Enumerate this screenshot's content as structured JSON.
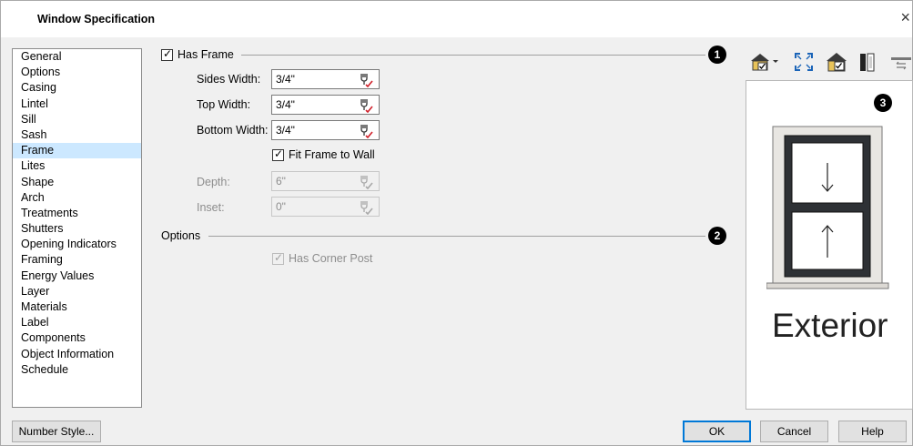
{
  "window": {
    "title": "Window Specification",
    "close_glyph": "×"
  },
  "nav": {
    "items": [
      {
        "label": "General"
      },
      {
        "label": "Options"
      },
      {
        "label": "Casing"
      },
      {
        "label": "Lintel"
      },
      {
        "label": "Sill"
      },
      {
        "label": "Sash"
      },
      {
        "label": "Frame",
        "selected": true
      },
      {
        "label": "Lites"
      },
      {
        "label": "Shape"
      },
      {
        "label": "Arch"
      },
      {
        "label": "Treatments"
      },
      {
        "label": "Shutters"
      },
      {
        "label": "Opening Indicators"
      },
      {
        "label": "Framing"
      },
      {
        "label": "Energy Values"
      },
      {
        "label": "Layer"
      },
      {
        "label": "Materials"
      },
      {
        "label": "Label"
      },
      {
        "label": "Components"
      },
      {
        "label": "Object Information"
      },
      {
        "label": "Schedule"
      }
    ]
  },
  "frame": {
    "has_frame_label": "Has Frame",
    "has_frame_checked": true,
    "sides_width_label": "Sides Width:",
    "sides_width_value": "3/4\"",
    "top_width_label": "Top Width:",
    "top_width_value": "3/4\"",
    "bottom_width_label": "Bottom Width:",
    "bottom_width_value": "3/4\"",
    "fit_frame_label": "Fit Frame to Wall",
    "fit_frame_checked": true,
    "depth_label": "Depth:",
    "depth_value": "6\"",
    "inset_label": "Inset:",
    "inset_value": "0\""
  },
  "options": {
    "group_label": "Options",
    "corner_post_label": "Has Corner Post",
    "corner_post_checked": true
  },
  "badges": {
    "one": "1",
    "two": "2",
    "three": "3"
  },
  "preview": {
    "caption": "Exterior"
  },
  "buttons": {
    "number_style": "Number Style...",
    "ok": "OK",
    "cancel": "Cancel",
    "help": "Help"
  },
  "icons": {
    "calculator": "calculator-icon",
    "toolbar": [
      "view-mode-dropdown-icon",
      "fill-window-icon",
      "color-view-icon",
      "side-view-icon",
      "flip-icon"
    ]
  },
  "colors": {
    "selection": "#cce8ff",
    "accent": "#0078d7",
    "calc_red": "#d0202a"
  }
}
